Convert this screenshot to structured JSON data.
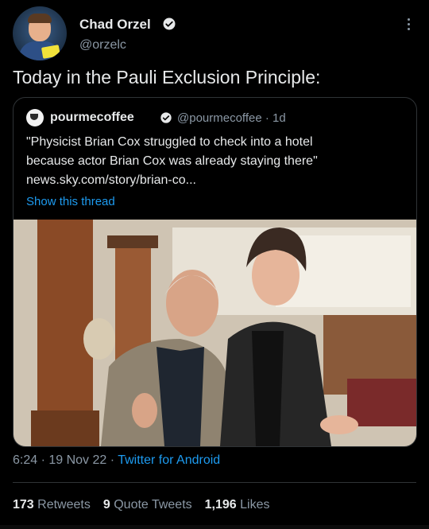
{
  "author": {
    "name": "Chad Orzel",
    "handle": "@orzelc",
    "avatar_icon": "profile-avatar",
    "verified_icon": "verified-badge-icon"
  },
  "tweet": {
    "text": "Today in the Pauli Exclusion Principle:"
  },
  "quoted": {
    "name": "pourmecoffee",
    "handle": "@pourmecoffee",
    "age": "· 1d",
    "lines": [
      "\"Physicist Brian Cox struggled to check into a hotel",
      "because actor Brian Cox was already staying there\"",
      "news.sky.com/story/brian-co..."
    ],
    "show_thread": "Show this thread"
  },
  "meta": {
    "time": "6:24",
    "sep1": " · ",
    "date": "19 Nov 22",
    "sep2": " · ",
    "source": "Twitter for Android"
  },
  "stats": {
    "retweets_count": "173",
    "retweets_label": "Retweets",
    "quotes_count": "9",
    "quotes_label": "Quote Tweets",
    "likes_count": "1,196",
    "likes_label": "Likes"
  },
  "colors": {
    "background": "#000000",
    "text": "#e7e9ea",
    "muted": "#8b98a5",
    "accent": "#1d9bf0",
    "border": "#2f3336"
  }
}
